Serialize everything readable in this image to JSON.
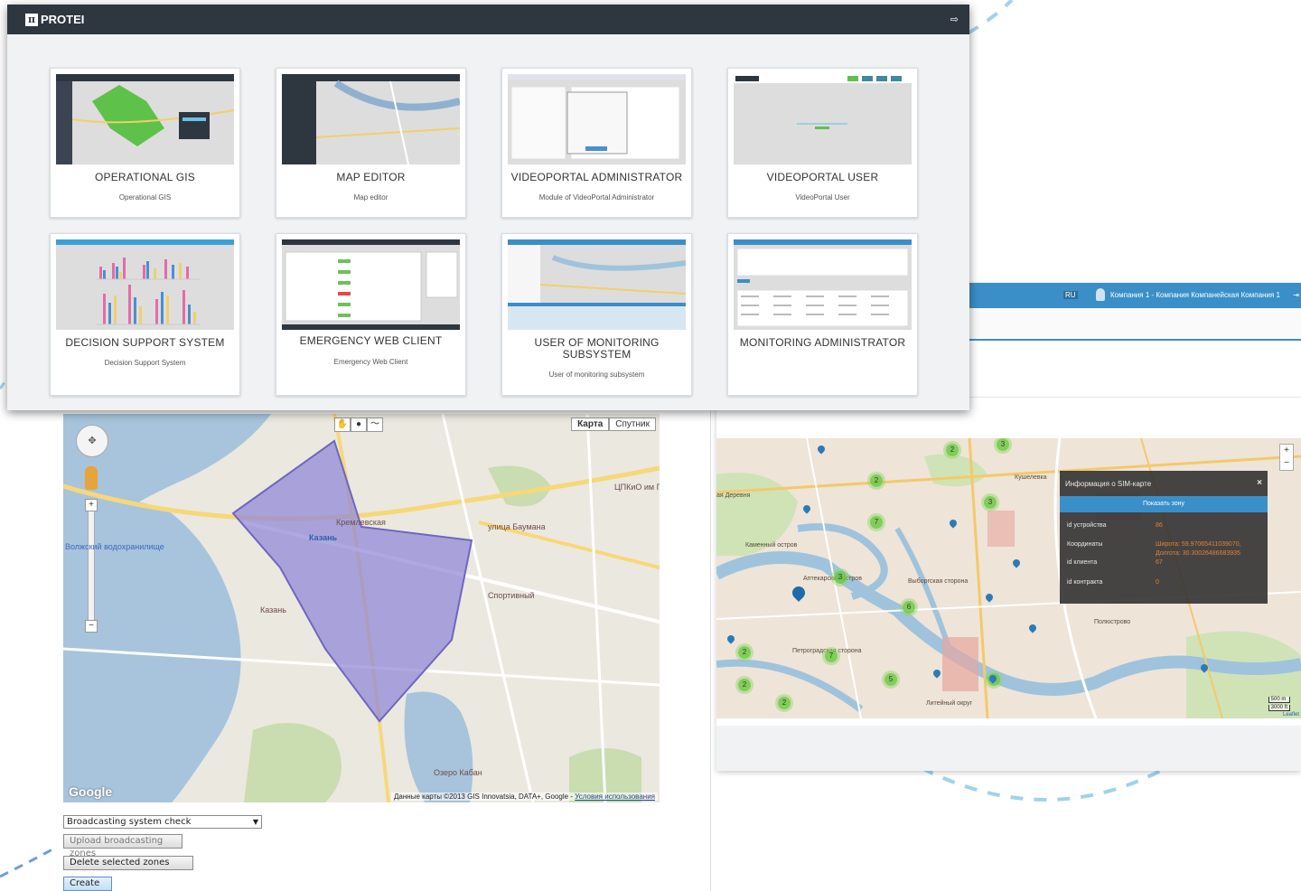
{
  "app": {
    "logo_text": "PROTEI",
    "logo_glyph": "π"
  },
  "cards": [
    {
      "title": "OPERATIONAL GIS",
      "subtitle": "Operational GIS"
    },
    {
      "title": "MAP EDITOR",
      "subtitle": "Map editor"
    },
    {
      "title": "VIDEOPORTAL ADMINISTRATOR",
      "subtitle": "Module of VideoPortal Administrator"
    },
    {
      "title": "VIDEOPORTAL USER",
      "subtitle": "VideoPortal User"
    },
    {
      "title": "DECISION SUPPORT SYSTEM",
      "subtitle": "Decision Support System"
    },
    {
      "title": "EMERGENCY WEB CLIENT",
      "subtitle": "Emergency Web Client"
    },
    {
      "title_line1": "USER OF MONITORING",
      "title_line2": "SUBSYSTEM",
      "subtitle": "User of monitoring subsystem"
    },
    {
      "title": "MONITORING ADMINISTRATOR",
      "subtitle": ""
    }
  ],
  "left_map": {
    "map_types": [
      "Карта",
      "Спутник"
    ],
    "city_label": "Казань",
    "labels": {
      "kremlin": "Кремлевская",
      "kazan_small": "Казань",
      "lake": "Озеро Кабан",
      "bay": "Волжский водохранилище",
      "sports": "Спортивный",
      "tsirk": "ЦПКиО им Горького",
      "kremlevskaya_st": "улица Баумана"
    },
    "google_logo": "Google",
    "attribution": "Данные карты ©2013 GIS Innovatsia, DATA+, Google -",
    "terms": "Условия использования",
    "select_value": "Broadcasting system check",
    "upload_label": "Upload broadcasting zones",
    "delete_label": "Delete selected zones",
    "create_label": "Create"
  },
  "right_map": {
    "lang_flag": "RU",
    "company_text": "Компания 1 - Компания Компанейская Компания 1",
    "popup": {
      "title": "Информация о SIM-карте",
      "close": "×",
      "show_zone": "Показать зону",
      "device_id_label": "id устройства",
      "device_id_value": "86",
      "coords_label": "Координаты",
      "lat_value": "Широта: 59.97065411039070,",
      "lon_value": "Долгота: 30.30026486683935",
      "client_id_label": "id клиента",
      "client_id_value": "67",
      "contract_id_label": "id контракта",
      "contract_id_value": "0"
    },
    "labels": {
      "kushelevka": "Кушелевка",
      "pioneer": "Полюстрово",
      "aptekarsky": "Аптекарский остров",
      "petrograd": "Петроградская сторона",
      "vyborg": "Выборгская сторона",
      "kamenny": "Каменный остров",
      "liteyny": "Литейный округ",
      "derevnya": "ая Деревня"
    },
    "clusters": [
      "2",
      "3",
      "2",
      "7",
      "3",
      "3",
      "6",
      "2",
      "2",
      "7",
      "5",
      "2",
      "3"
    ],
    "scale_m": "500 m",
    "scale_ft": "3000 ft",
    "leaflet": "Leaflet",
    "zoom_in": "+",
    "zoom_out": "−"
  },
  "colors": {
    "header_dark": "#2e3640",
    "panel_bg": "#f0f2f4",
    "accent_blue": "#3a8fc8",
    "zone_fill": "#8f86d8",
    "popup_value": "#e0813a"
  }
}
